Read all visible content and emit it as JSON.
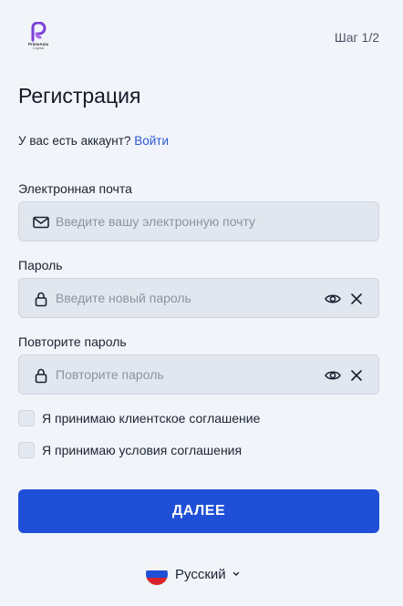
{
  "header": {
    "logo_name": "PrimeAsia",
    "logo_sub": "Capital",
    "step": "Шаг 1/2"
  },
  "title": "Регистрация",
  "account": {
    "question": "У вас есть аккаунт?",
    "login_link": "Войти"
  },
  "form": {
    "email": {
      "label": "Электронная почта",
      "placeholder": "Введите вашу электронную почту",
      "icon": "mail-icon"
    },
    "password": {
      "label": "Пароль",
      "placeholder": "Введите новый пароль",
      "icon": "lock-icon"
    },
    "repeat_password": {
      "label": "Повторите пароль",
      "placeholder": "Повторите пароль",
      "icon": "lock-icon"
    },
    "checkboxes": [
      {
        "label": "Я принимаю клиентское соглашение",
        "checked": false
      },
      {
        "label": "Я принимаю условия соглашения",
        "checked": false
      }
    ],
    "next_label": "ДАЛЕЕ"
  },
  "language": {
    "label": "Русский",
    "flag": "russia-flag-icon"
  },
  "colors": {
    "accent": "#1f4fd6",
    "link": "#2d5bd6",
    "background": "#f1f4f9",
    "field_bg": "#e2e7ef",
    "logo": "#7b3fd9"
  }
}
